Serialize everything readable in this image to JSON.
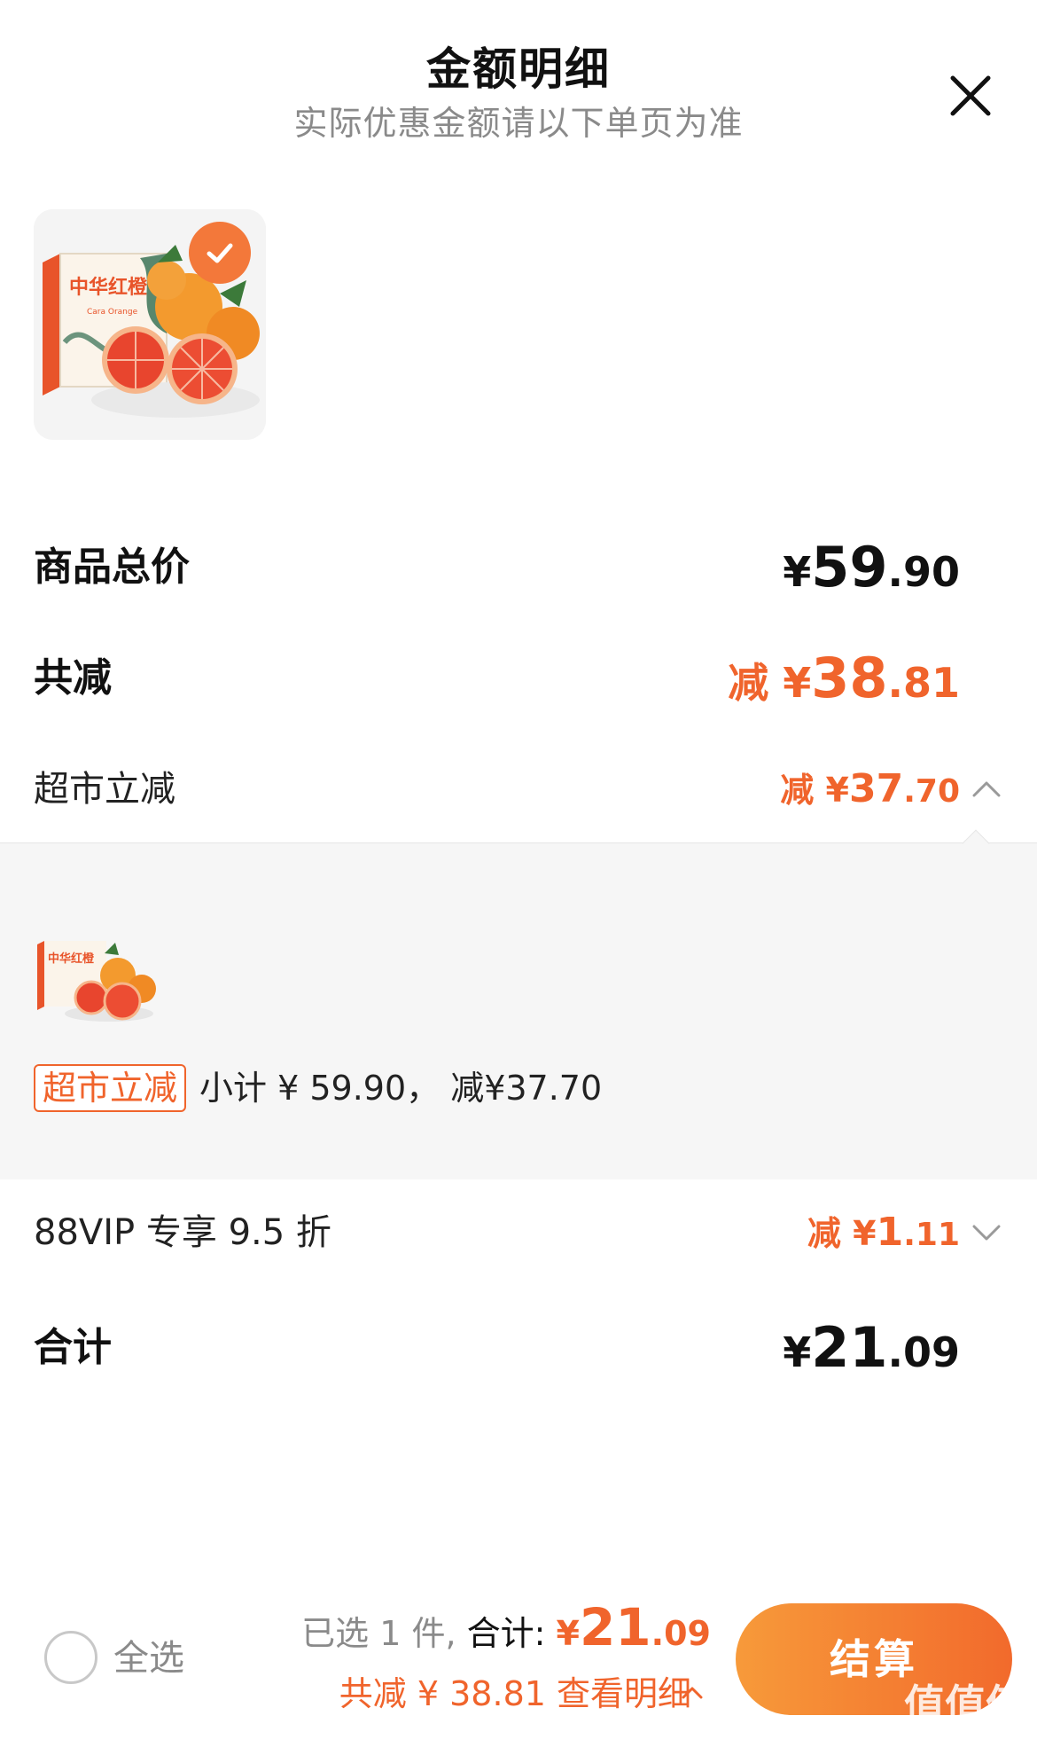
{
  "header": {
    "title": "金额明细",
    "subtitle": "实际优惠金额请以下单页为准"
  },
  "product": {
    "image_name": "中华红橙",
    "image_sub": "Cara Orange",
    "selected": true
  },
  "rows": {
    "goods_total": {
      "label": "商品总价",
      "symbol": "¥",
      "int": "59",
      "dec": ".90"
    },
    "total_reduce": {
      "label": "共减",
      "prefix": "减 ",
      "symbol": "¥",
      "int": "38",
      "dec": ".81"
    },
    "supermarket": {
      "label": "超市立减",
      "prefix": "减 ",
      "symbol": "¥",
      "int": "37",
      "dec": ".70",
      "expanded": true
    },
    "vip": {
      "label": "88VIP 专享 9.5 折",
      "prefix": "减 ",
      "symbol": "¥",
      "int": "1",
      "dec": ".11",
      "expanded": false
    },
    "sum": {
      "label": "合计",
      "symbol": "¥",
      "int": "21",
      "dec": ".09"
    }
  },
  "detail_panel": {
    "tag": "超市立减",
    "subtotal": "小计 ¥ 59.90， 减¥37.70"
  },
  "bottom_bar": {
    "select_all": "全选",
    "selected_count": "已选 1 件, ",
    "total_label": "合计: ",
    "total_symbol": "¥",
    "total_int": "21",
    "total_dec": ".09",
    "reduce_text": "共减 ¥ 38.81  查看明细",
    "checkout": "结算"
  },
  "watermark": {
    "text": "值值值",
    "url": "zhizhizhi.com"
  },
  "colors": {
    "accent": "#f0642c",
    "button_start": "#f79a3a",
    "button_end": "#f26a2c",
    "panel_bg": "#f6f6f6",
    "muted": "#8a8a8a"
  }
}
